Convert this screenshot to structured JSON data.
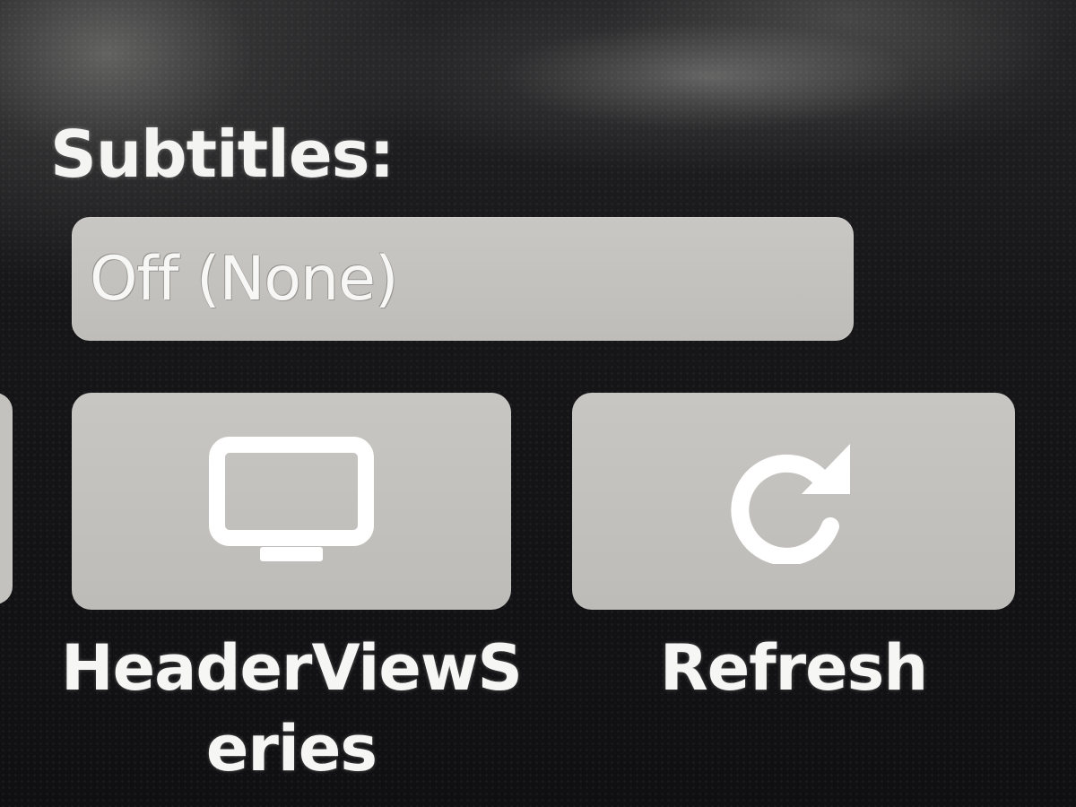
{
  "subtitles": {
    "label": "Subtitles:",
    "selected_value": "Off (None)"
  },
  "actions": [
    {
      "label": "HeaderViewSeries",
      "icon": "tv-icon"
    },
    {
      "label": "Refresh",
      "icon": "refresh-icon"
    }
  ]
}
